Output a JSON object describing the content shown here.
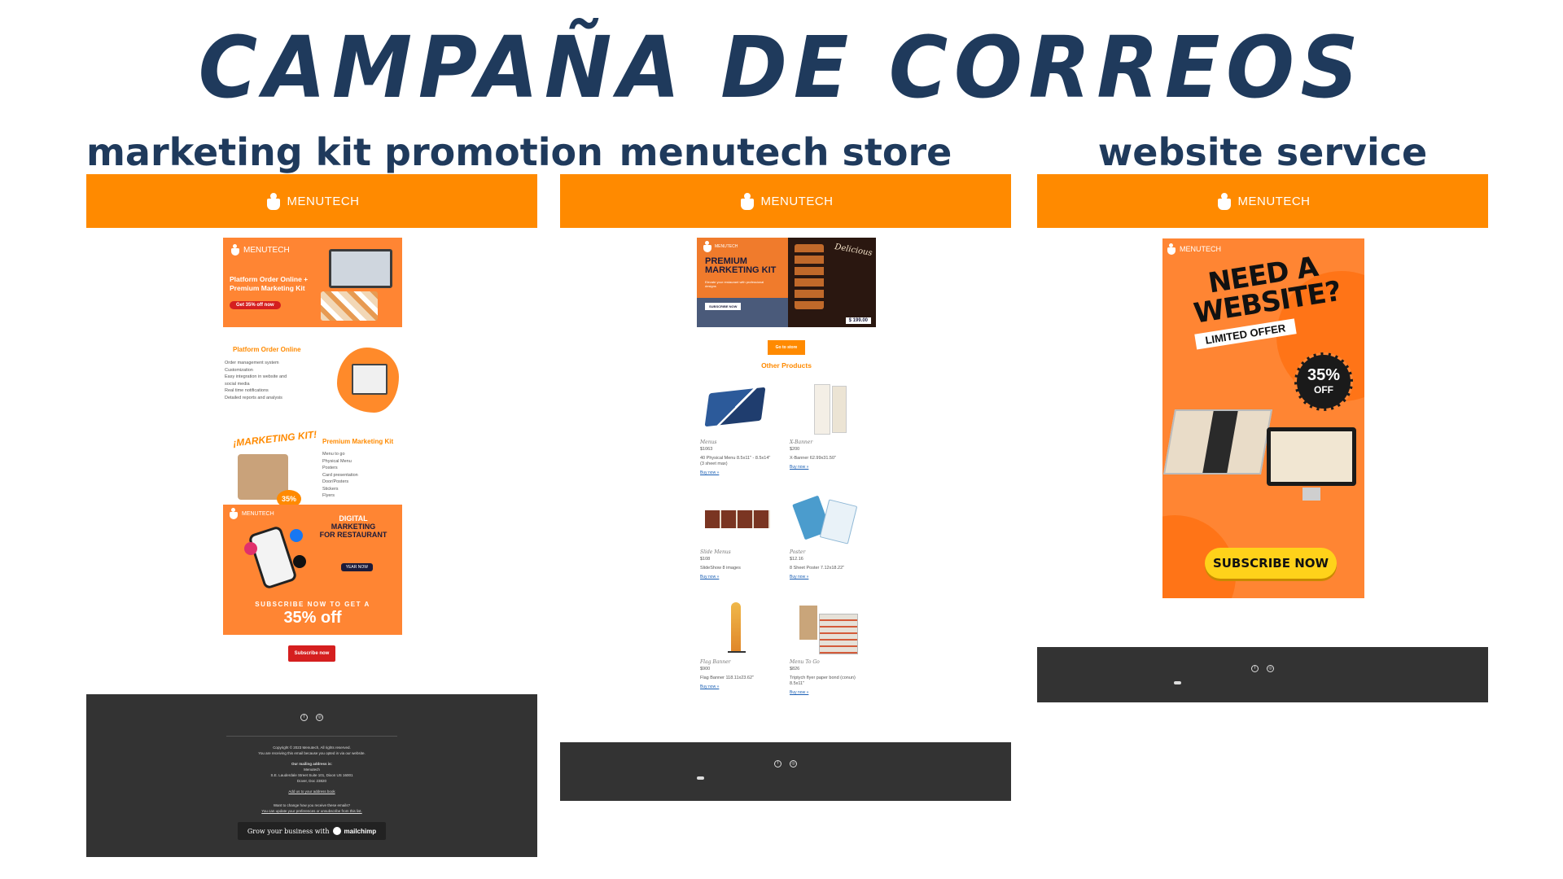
{
  "page": {
    "title": "CAMPAÑA DE CORREOS"
  },
  "brand": {
    "name": "MENUTECH",
    "accent": "#ff8a00",
    "dark_footer": "#333333",
    "title_color": "#1f3a5c"
  },
  "columns": [
    {
      "title": "marketing kit promotion",
      "hero": {
        "brand": "MENUTECH",
        "headline": "Platform Order Online + Premium Marketing Kit",
        "button": "Get 35% off now"
      },
      "section_platform": {
        "heading": "Platform Order Online",
        "items": [
          "Order management system",
          "Customization",
          "Easy integration in website and",
          "social media",
          "Real time notifications",
          "Detailed reports and analysis"
        ]
      },
      "section_kit": {
        "art_word": "¡MARKETING KIT!",
        "art_pct": "35%",
        "heading": "Premium Marketing Kit",
        "items": [
          "Menu to go",
          "Physical Menu",
          "Posters",
          "Card presentation",
          "Door/Posters",
          "Stickers",
          "Flyers"
        ]
      },
      "digital": {
        "brand": "MENUTECH",
        "title_line1": "DIGITAL",
        "title_line2": "MARKETING",
        "title_line3": "FOR RESTAURANT",
        "year_button": "YEAR NOW",
        "subscribe_line": "SUBSCRIBE NOW TO GET A",
        "pct_line": "35% off"
      },
      "subscribe_button": "Subscribe now",
      "footer": {
        "copyright": "Copyright © 2023 Menutech, All rights reserved.",
        "reason": "You are receiving this email because you opted in via our website.",
        "address_label": "Our mailing address is:",
        "company": "Menutech",
        "street": "S.E. Lauderdale Street Suite 101, Dixon US  16001",
        "city": "Dover, Doc 23820",
        "add_book": "Add us to your address book",
        "change_q": "Want to change how you receive these emails?",
        "change_text": "You can update your preferences or unsubscribe from this list.",
        "grow_text": "Grow your business with",
        "mc_word": "mailchimp"
      }
    },
    {
      "title": "menutech store",
      "hero": {
        "brand": "MENUTECH",
        "title_line1": "PREMIUM",
        "title_line2": "MARKETING KIT",
        "subtitle": "Elevate your restaurant with professional designs",
        "button": "SUBSCRIBE NOW",
        "script_word": "Delicious",
        "price": "$ 199.00"
      },
      "store_button": "Go to store",
      "other_heading": "Other Products",
      "products": [
        {
          "name": "Menus",
          "price": "$1063",
          "desc": "40 Physical Menu 8.5x11\" - 8.5x14\" (3 sheet max)",
          "link": "Buy now »"
        },
        {
          "name": "X-Banner",
          "price": "$200",
          "desc": "X-Banner 62.99x31.50\"",
          "link": "Buy now »"
        },
        {
          "name": "Slide Menus",
          "price": "$108",
          "desc": "SlideShow 8 images",
          "link": "Buy now »"
        },
        {
          "name": "Poster",
          "price": "$12.16",
          "desc": "8 Sheet Poster 7.12x18.22\"",
          "link": "Buy now »"
        },
        {
          "name": "Flag Banner",
          "price": "$900",
          "desc": "Flag Banner 118.11x23.62\"",
          "link": "Buy now »"
        },
        {
          "name": "Menu To Go",
          "price": "$826",
          "desc": "Triptych flyer paper bond (conun) 8.5x11\"",
          "link": "Buy now »"
        }
      ]
    },
    {
      "title": "website service",
      "poster": {
        "brand": "MENUTECH",
        "headline": "NEED A WEBSITE?",
        "limited": "LIMITED OFFER",
        "pct": "35%",
        "off": "OFF",
        "button": "SUBSCRIBE NOW"
      }
    }
  ],
  "social": {
    "facebook_glyph": "f",
    "instagram_glyph": "◎"
  }
}
